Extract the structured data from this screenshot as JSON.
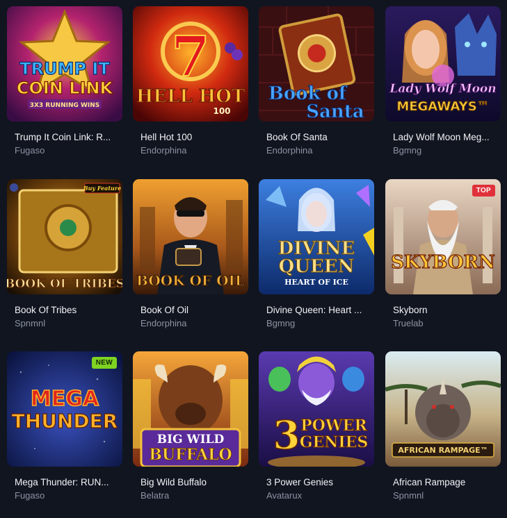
{
  "games": [
    {
      "title": "Trump It Coin Link: R...",
      "provider": "Fugaso",
      "art_lines": [
        "TRUMP IT",
        "COIN LINK",
        "3X3 RUNNING WINS"
      ]
    },
    {
      "title": "Hell Hot 100",
      "provider": "Endorphina",
      "art_lines": [
        "HELL HOT",
        "100"
      ]
    },
    {
      "title": "Book Of Santa",
      "provider": "Endorphina",
      "art_lines": [
        "Book of",
        "Santa"
      ]
    },
    {
      "title": "Lady Wolf Moon Meg...",
      "provider": "Bgmng",
      "art_lines": [
        "Lady Wolf Moon",
        "MEGAWAYS™"
      ]
    },
    {
      "title": "Book Of Tribes",
      "provider": "Spnmnl",
      "art_lines": [
        "BOOK OF TRIBES",
        "Buy Feature"
      ]
    },
    {
      "title": "Book Of Oil",
      "provider": "Endorphina",
      "art_lines": [
        "BOOK OF OIL"
      ]
    },
    {
      "title": "Divine Queen: Heart ...",
      "provider": "Bgmng",
      "art_lines": [
        "DIVINE",
        "QUEEN",
        "HEART OF ICE"
      ]
    },
    {
      "title": "Skyborn",
      "provider": "Truelab",
      "badge": "TOP",
      "art_lines": [
        "SKYBORN"
      ]
    },
    {
      "title": "Mega Thunder: RUN...",
      "provider": "Fugaso",
      "badge": "NEW",
      "art_lines": [
        "MEGA",
        "THUNDER"
      ]
    },
    {
      "title": "Big Wild Buffalo",
      "provider": "Belatra",
      "art_lines": [
        "BIG WILD",
        "BUFFALO"
      ]
    },
    {
      "title": "3 Power Genies",
      "provider": "Avatarux",
      "art_lines": [
        "3",
        "POWER",
        "GENIES"
      ]
    },
    {
      "title": "African Rampage",
      "provider": "Spnmnl",
      "art_lines": [
        "AFRICAN RAMPAGE™"
      ]
    }
  ]
}
